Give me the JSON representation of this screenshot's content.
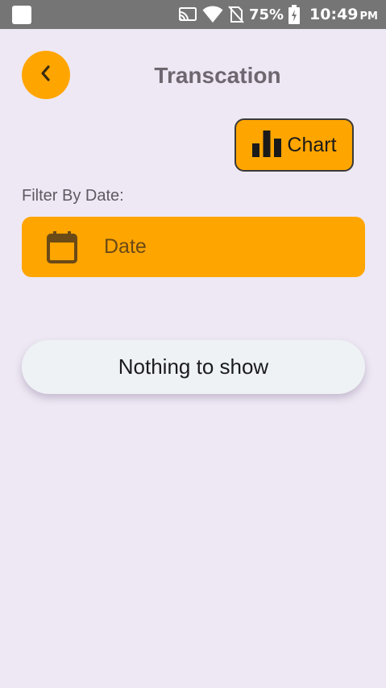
{
  "status_bar": {
    "battery_percent": "75%",
    "time": "10:49",
    "ampm": "PM",
    "icons": [
      "notification-icon",
      "cast-icon",
      "wifi-icon",
      "no-sim-icon",
      "battery-charging-icon"
    ]
  },
  "header": {
    "title": "Transcation",
    "back_icon": "chevron-left-icon"
  },
  "chart_button": {
    "label": "Chart",
    "icon": "bar-chart-icon"
  },
  "filter": {
    "label": "Filter By Date:",
    "date_button_label": "Date",
    "icon": "calendar-icon"
  },
  "empty_state": {
    "text": "Nothing to show"
  },
  "colors": {
    "accent": "#FFA500",
    "background": "#EEE8F4",
    "status_bar": "#757575",
    "card": "#EFF2F5"
  }
}
